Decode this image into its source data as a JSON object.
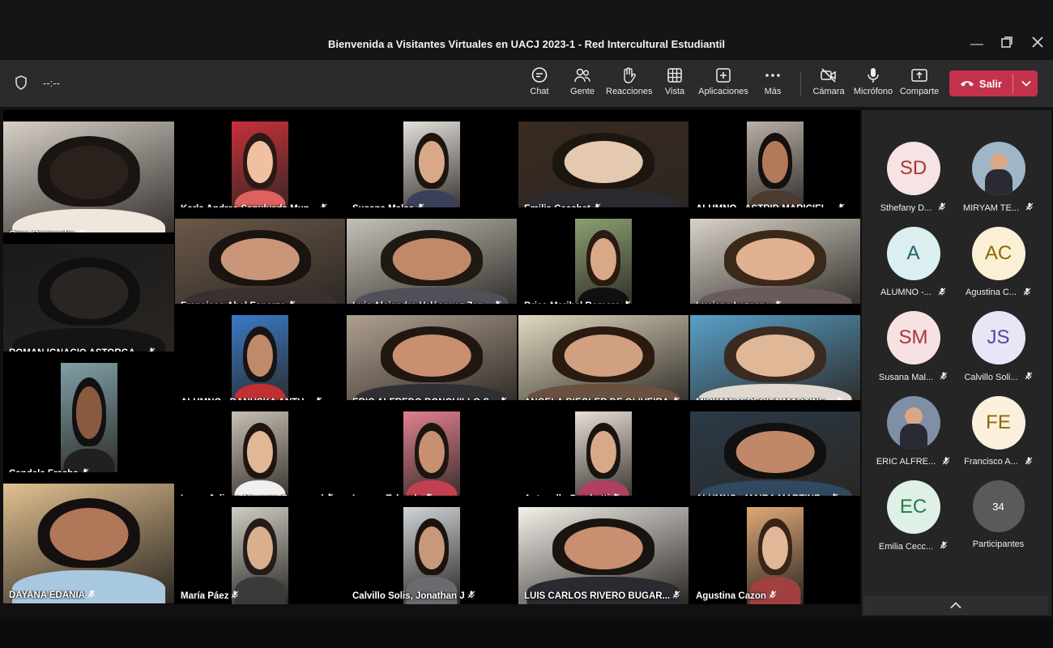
{
  "window": {
    "title": "Bienvenida a Visitantes Virtuales en UACJ 2023-1 - Red Intercultural Estudiantil"
  },
  "toolbar": {
    "timer": "--:--",
    "buttons": [
      {
        "label": "Chat",
        "icon": "chat-icon"
      },
      {
        "label": "Gente",
        "icon": "people-icon"
      },
      {
        "label": "Reacciones",
        "icon": "raise-hand-icon"
      },
      {
        "label": "Vista",
        "icon": "grid-view-icon"
      },
      {
        "label": "Aplicaciones",
        "icon": "add-app-icon"
      },
      {
        "label": "Más",
        "icon": "more-icon"
      },
      {
        "label": "Cámara",
        "icon": "camera-off-icon"
      },
      {
        "label": "Micrófono",
        "icon": "microphone-icon"
      },
      {
        "label": "Comparte",
        "icon": "share-icon"
      }
    ],
    "leave_label": "Salir",
    "leave_color": "#c4314b"
  },
  "participants_grid": [
    "Gina Bergaglio",
    "Karla Andrea Sepulveda Mun...",
    "Susana Malca",
    "Emilia Cecchet",
    "ALUMNO - ASTRID MARICIEL...",
    "Francisco Abel Esparza",
    "Luis Alejandro Velásquez Zap...",
    "Brisa Maribel Romero",
    "Luciana Lezcano",
    "ROMAN IGNACIO ASTORGA ...",
    "ALUMNO - DANUSKA ANTU...",
    "ERIC ALFREDO RONQUILLO S...",
    "ANGELA BIEGLER DE OLIVEIRA",
    "MIRYAM TERESITA MARTINE...",
    "Candela Fracha",
    "Laren Juliana Navarro Carrascal",
    "Lorena Taborda",
    "Antonella Gambetti",
    "ALUMNO - MAIRA MARTINE...",
    "DAYANA EDANIA",
    "María Páez",
    "Calvillo Solis, Jonathan J",
    "LUIS CARLOS RIVERO BUGAR...",
    "Agustina Cazon"
  ],
  "side_panel": [
    {
      "initials": "SD",
      "label": "Sthefany D...",
      "bg": "#f6e3e3",
      "fg": "#a4373a"
    },
    {
      "initials": "",
      "label": "MIRYAM TE...",
      "bg": "#9fb6c9",
      "fg": "#ffffff"
    },
    {
      "initials": "A",
      "label": "ALUMNO -...",
      "bg": "#dbeef0",
      "fg": "#1e5f6b"
    },
    {
      "initials": "AC",
      "label": "Agustina C...",
      "bg": "#fbf0d6",
      "fg": "#8a6a00"
    },
    {
      "initials": "SM",
      "label": "Susana Mal...",
      "bg": "#f6e1e3",
      "fg": "#a4373a"
    },
    {
      "initials": "JS",
      "label": "Calvillo Soli...",
      "bg": "#e8e6f6",
      "fg": "#4f4aa0"
    },
    {
      "initials": "",
      "label": "ERIC ALFRE...",
      "bg": "#7f8fa5",
      "fg": "#ffffff"
    },
    {
      "initials": "FE",
      "label": "Francisco A...",
      "bg": "#fbf0dc",
      "fg": "#8a6a00"
    },
    {
      "initials": "EC",
      "label": "Emilia Cecc...",
      "bg": "#dff0e6",
      "fg": "#237b4b"
    },
    {
      "initials": "34",
      "label": "Participantes",
      "bg": "#5a5a5a",
      "fg": "#ffffff"
    }
  ]
}
